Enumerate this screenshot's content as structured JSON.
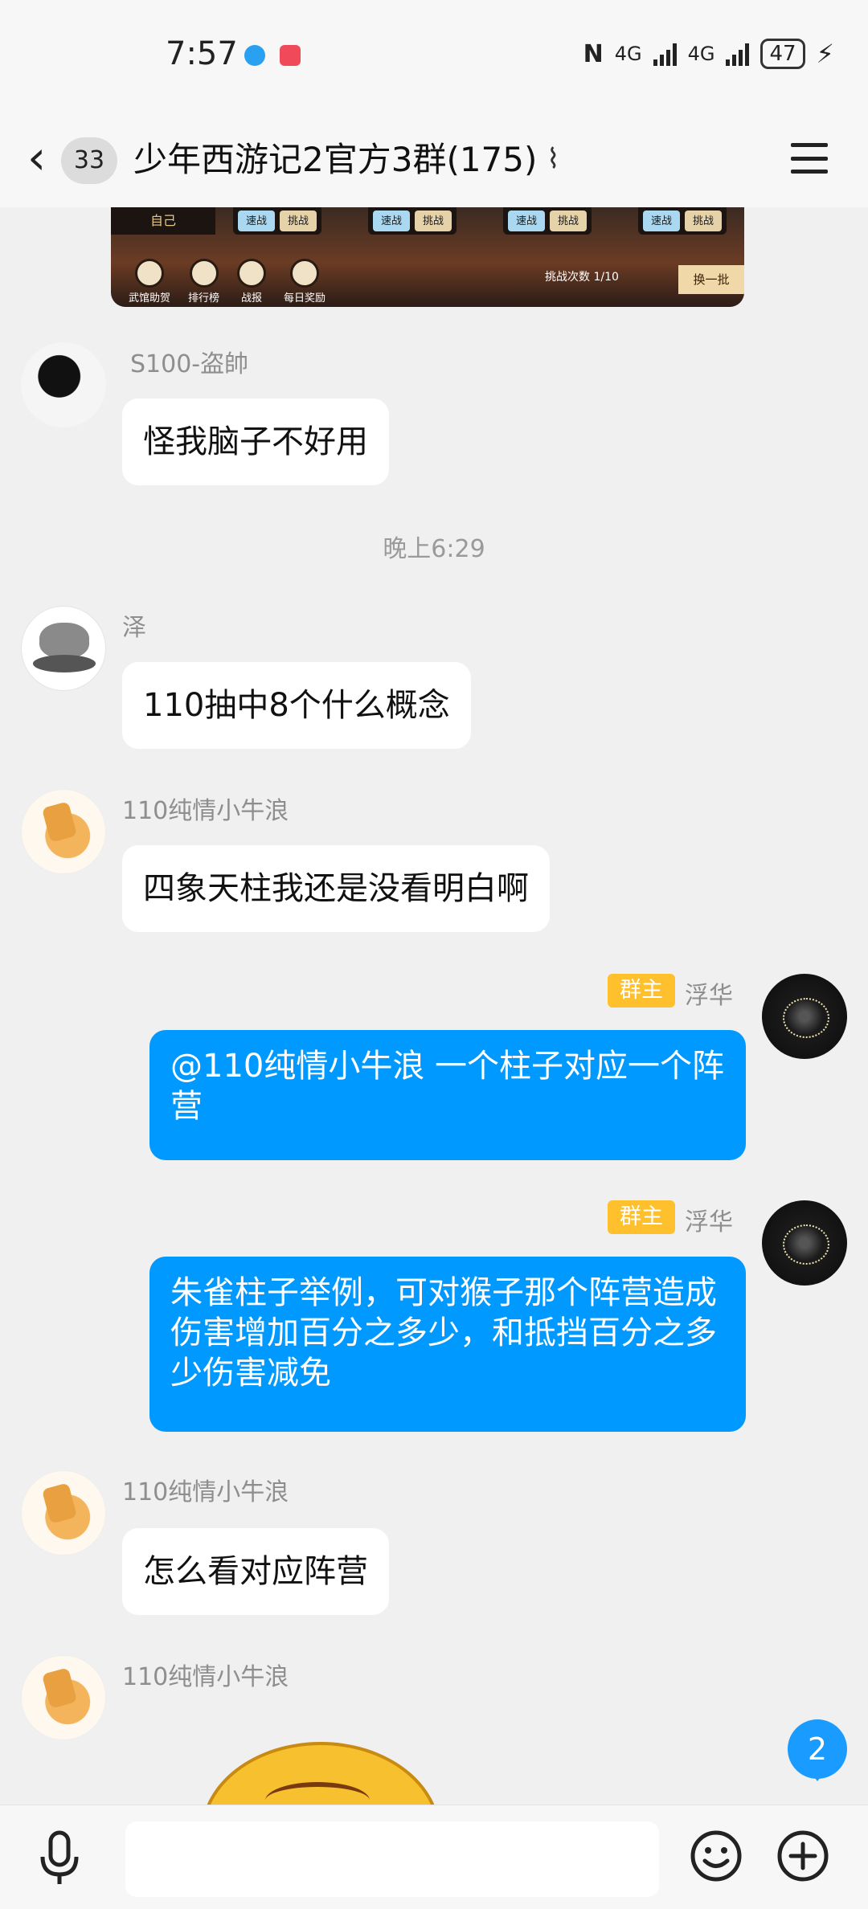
{
  "status": {
    "time": "7:57",
    "net1": "4G",
    "net2": "4G",
    "battery": "47"
  },
  "header": {
    "back_count": "33",
    "title": "少年西游记2官方3群(175)"
  },
  "game_image": {
    "self_label": "自己",
    "speed_label": "速战",
    "challenge_label": "挑战",
    "icons": [
      "武馆助贺",
      "排行榜",
      "战报",
      "每日奖励"
    ],
    "challenge_count": "挑战次数 1/10",
    "refresh_label": "换一批"
  },
  "messages": [
    {
      "sender": "S100-盗帥",
      "text": "怪我脑子不好用"
    },
    {
      "sender": "泽",
      "text": "110抽中8个什么概念"
    },
    {
      "sender": "110纯情小牛浪",
      "text": "四象天柱我还是没看明白啊"
    },
    {
      "sender": "浮华",
      "badge": "群主",
      "text": "@110纯情小牛浪 一个柱子对应一个阵营"
    },
    {
      "sender": "浮华",
      "badge": "群主",
      "text": "朱雀柱子举例，可对猴子那个阵营造成伤害增加百分之多少，和抵挡百分之多少伤害减免"
    },
    {
      "sender": "110纯情小牛浪",
      "text": "怎么看对应阵营"
    },
    {
      "sender": "110纯情小牛浪"
    }
  ],
  "timestamp": "晚上6:29",
  "unread": "2",
  "input": {
    "placeholder": ""
  },
  "colors": {
    "bubble_self": "#0099ff",
    "owner_badge": "#ffc02e",
    "background": "#f0f0f0"
  },
  "icons": [
    "back-icon",
    "ear-icon",
    "menu-icon",
    "mic-icon",
    "emoji-icon",
    "plus-icon"
  ]
}
